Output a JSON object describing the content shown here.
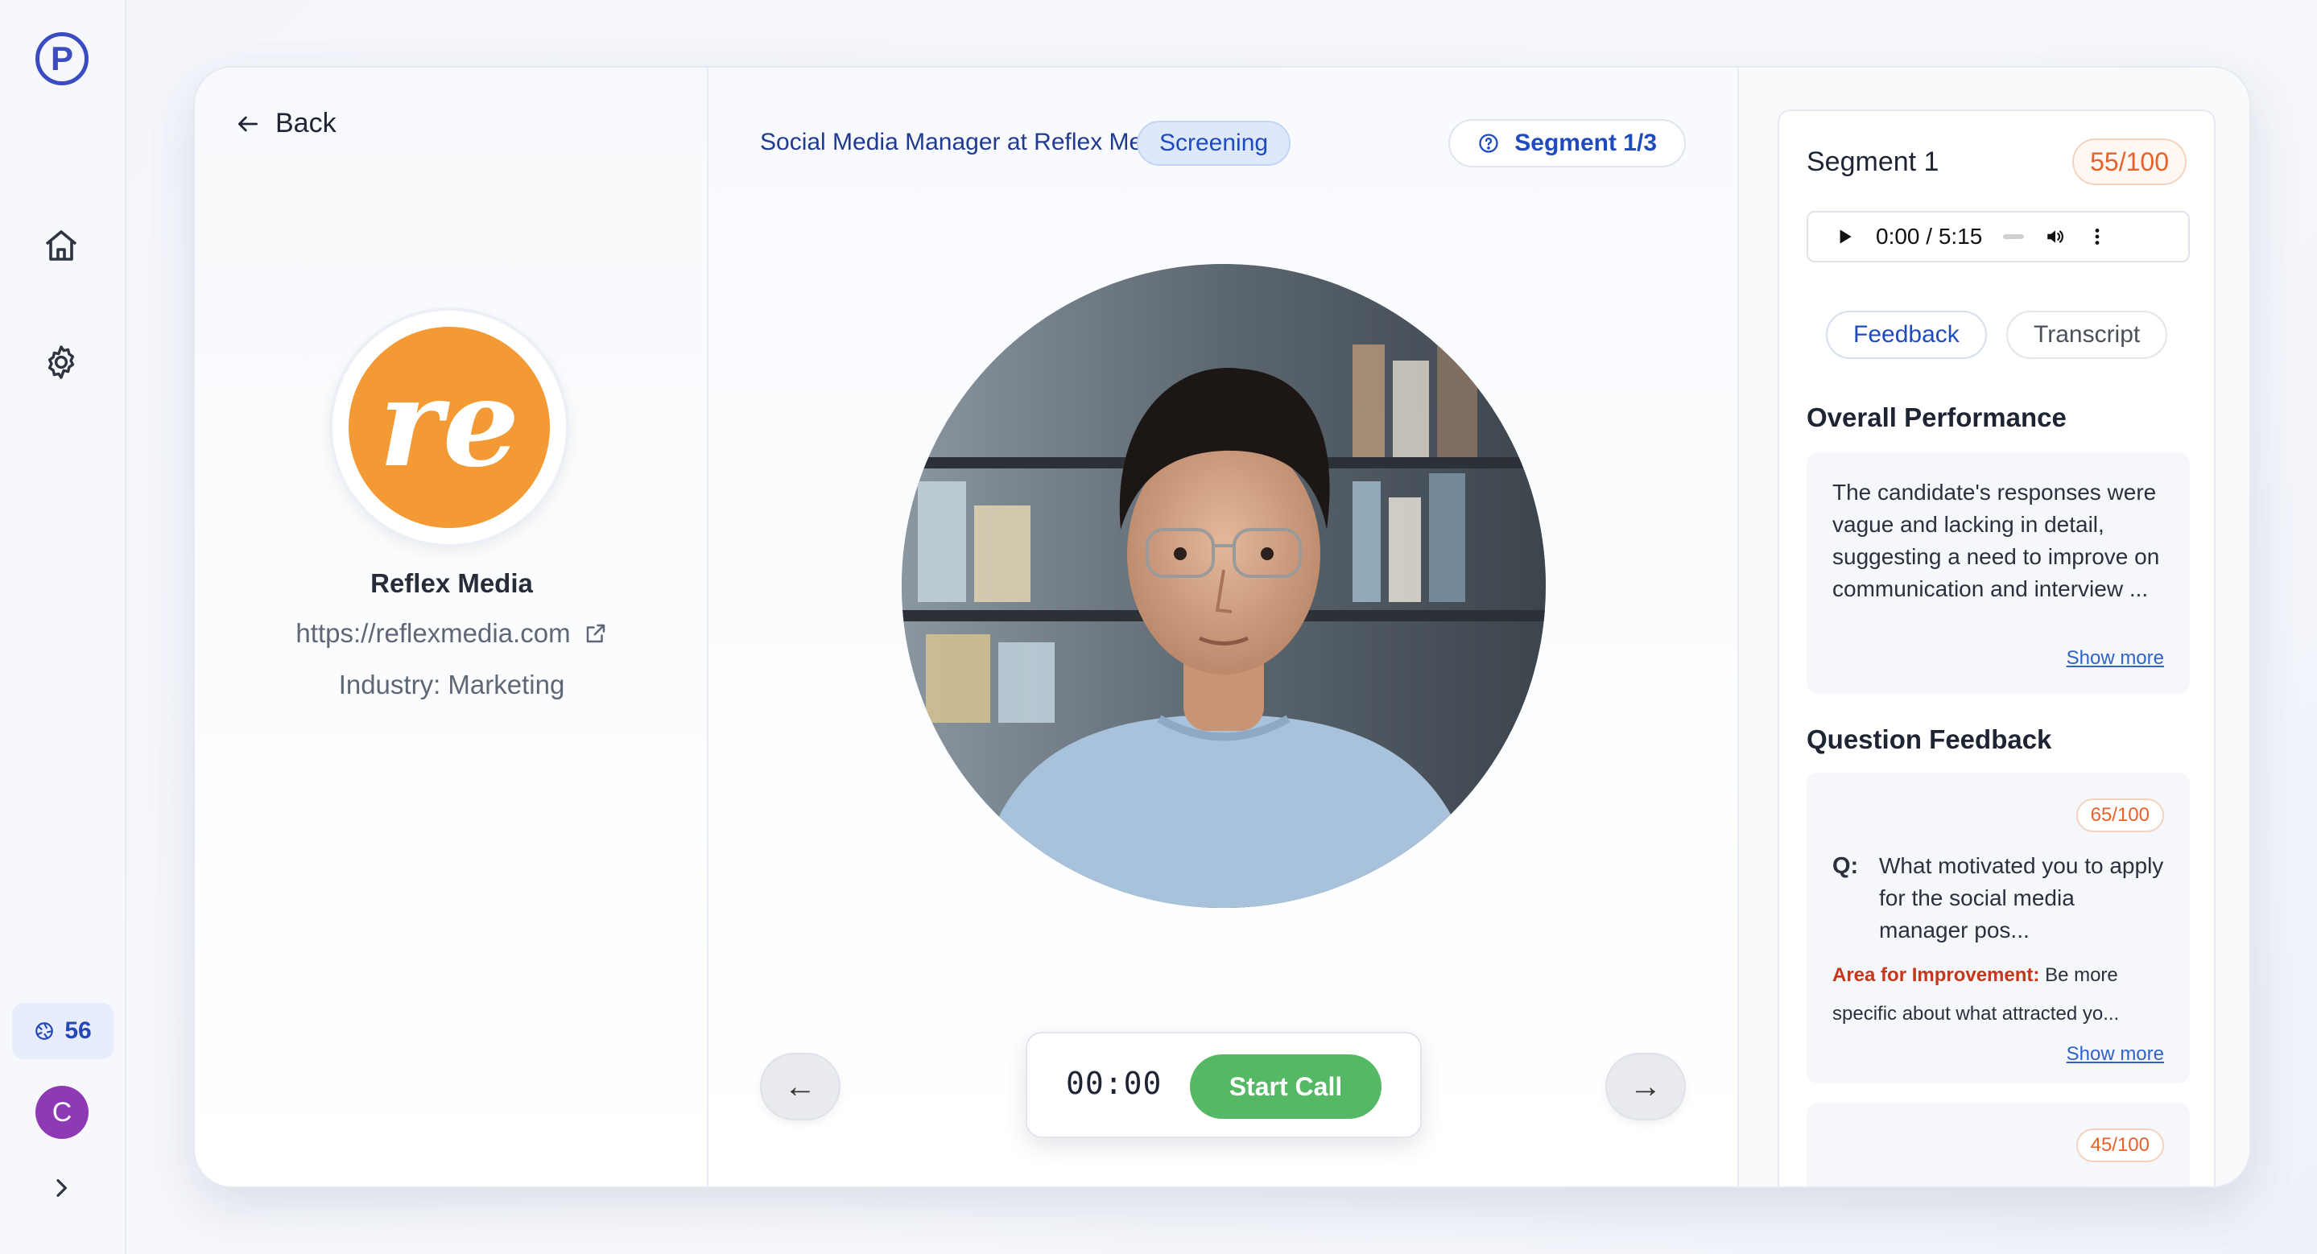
{
  "sidebar": {
    "logo_letter": "P",
    "credits": "56",
    "avatar_initial": "C"
  },
  "company": {
    "back_label": "Back",
    "name": "Reflex Media",
    "logo_text": "re",
    "url": "https://reflexmedia.com",
    "industry": "Industry: Marketing"
  },
  "interview": {
    "job_title": "Social Media Manager at Reflex Media",
    "stage": "Screening",
    "segment": "Segment 1/3",
    "prev_arrow": "←",
    "next_arrow": "→",
    "timer": "00:00",
    "start_call_label": "Start Call"
  },
  "review": {
    "segment_title": "Segment 1",
    "segment_score": "55/100",
    "audio_time": "0:00 / 5:15",
    "tabs": [
      {
        "label": "Feedback",
        "active": true
      },
      {
        "label": "Transcript",
        "active": false
      }
    ],
    "overall_title": "Overall Performance",
    "overall_text": "The candidate's responses were vague and lacking in detail, suggesting a need to improve on communication and interview ...",
    "show_more": "Show more",
    "question_title": "Question Feedback",
    "questions": [
      {
        "score": "65/100",
        "q_label": "Q:",
        "question": "What motivated you to apply for the social media manager pos...",
        "improvement_label": "Area for Improvement:",
        "improvement_text": "Be more specific about what attracted yo...",
        "show_more": "Show more"
      },
      {
        "score": "45/100"
      }
    ]
  },
  "colors": {
    "accent": "#1f4bbf",
    "score": "#e8612a",
    "start_call": "#55b865",
    "improvement": "#c6361a",
    "brand_logo": "#f39a34"
  }
}
